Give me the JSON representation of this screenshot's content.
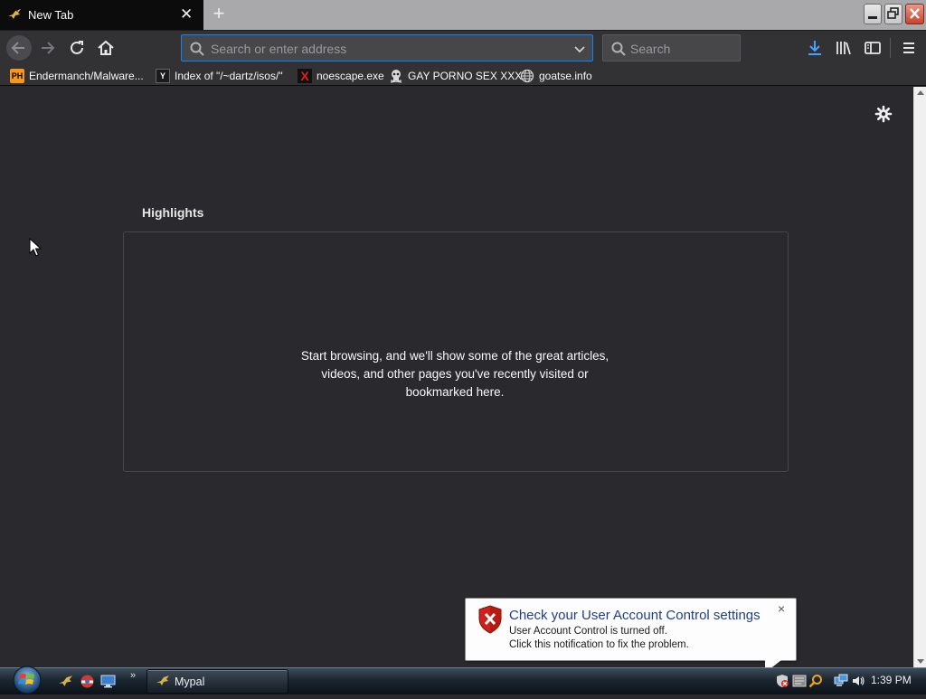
{
  "tab": {
    "title": "New Tab",
    "close": "✕"
  },
  "newtab_symbol": "+",
  "nav": {
    "url_placeholder": "Search or enter address",
    "search_placeholder": "Search"
  },
  "bookmarks": [
    {
      "label": "Endermanch/Malware...",
      "icon": "pornhub-icon",
      "icon_text": "PH"
    },
    {
      "label": "Index of \"/~dartz/isos/\"",
      "icon": "ycombinator-icon",
      "icon_text": "Y"
    },
    {
      "label": "noescape.exe",
      "icon": "red-x-icon",
      "icon_text": "X"
    },
    {
      "label": "GAY PORNO SEX XXX",
      "icon": "skull-icon",
      "icon_text": ""
    },
    {
      "label": "goatse.info",
      "icon": "globe-icon",
      "icon_text": ""
    }
  ],
  "highlights": {
    "title": "Highlights",
    "empty_text": "Start browsing, and we'll show some of the great articles, videos, and other pages you've recently visited or bookmarked here."
  },
  "notification": {
    "title": "Check your User Account Control settings",
    "line1": "User Account Control is turned off.",
    "line2": "Click this notification to fix the problem.",
    "close": "×"
  },
  "taskbar": {
    "more": "»",
    "task_label": "Mypal",
    "clock": "1:39 PM"
  },
  "colors": {
    "background": "#2a2a2e",
    "toolbar": "#323234",
    "accent": "#0a84ff",
    "notif_title": "#1e3f87"
  }
}
